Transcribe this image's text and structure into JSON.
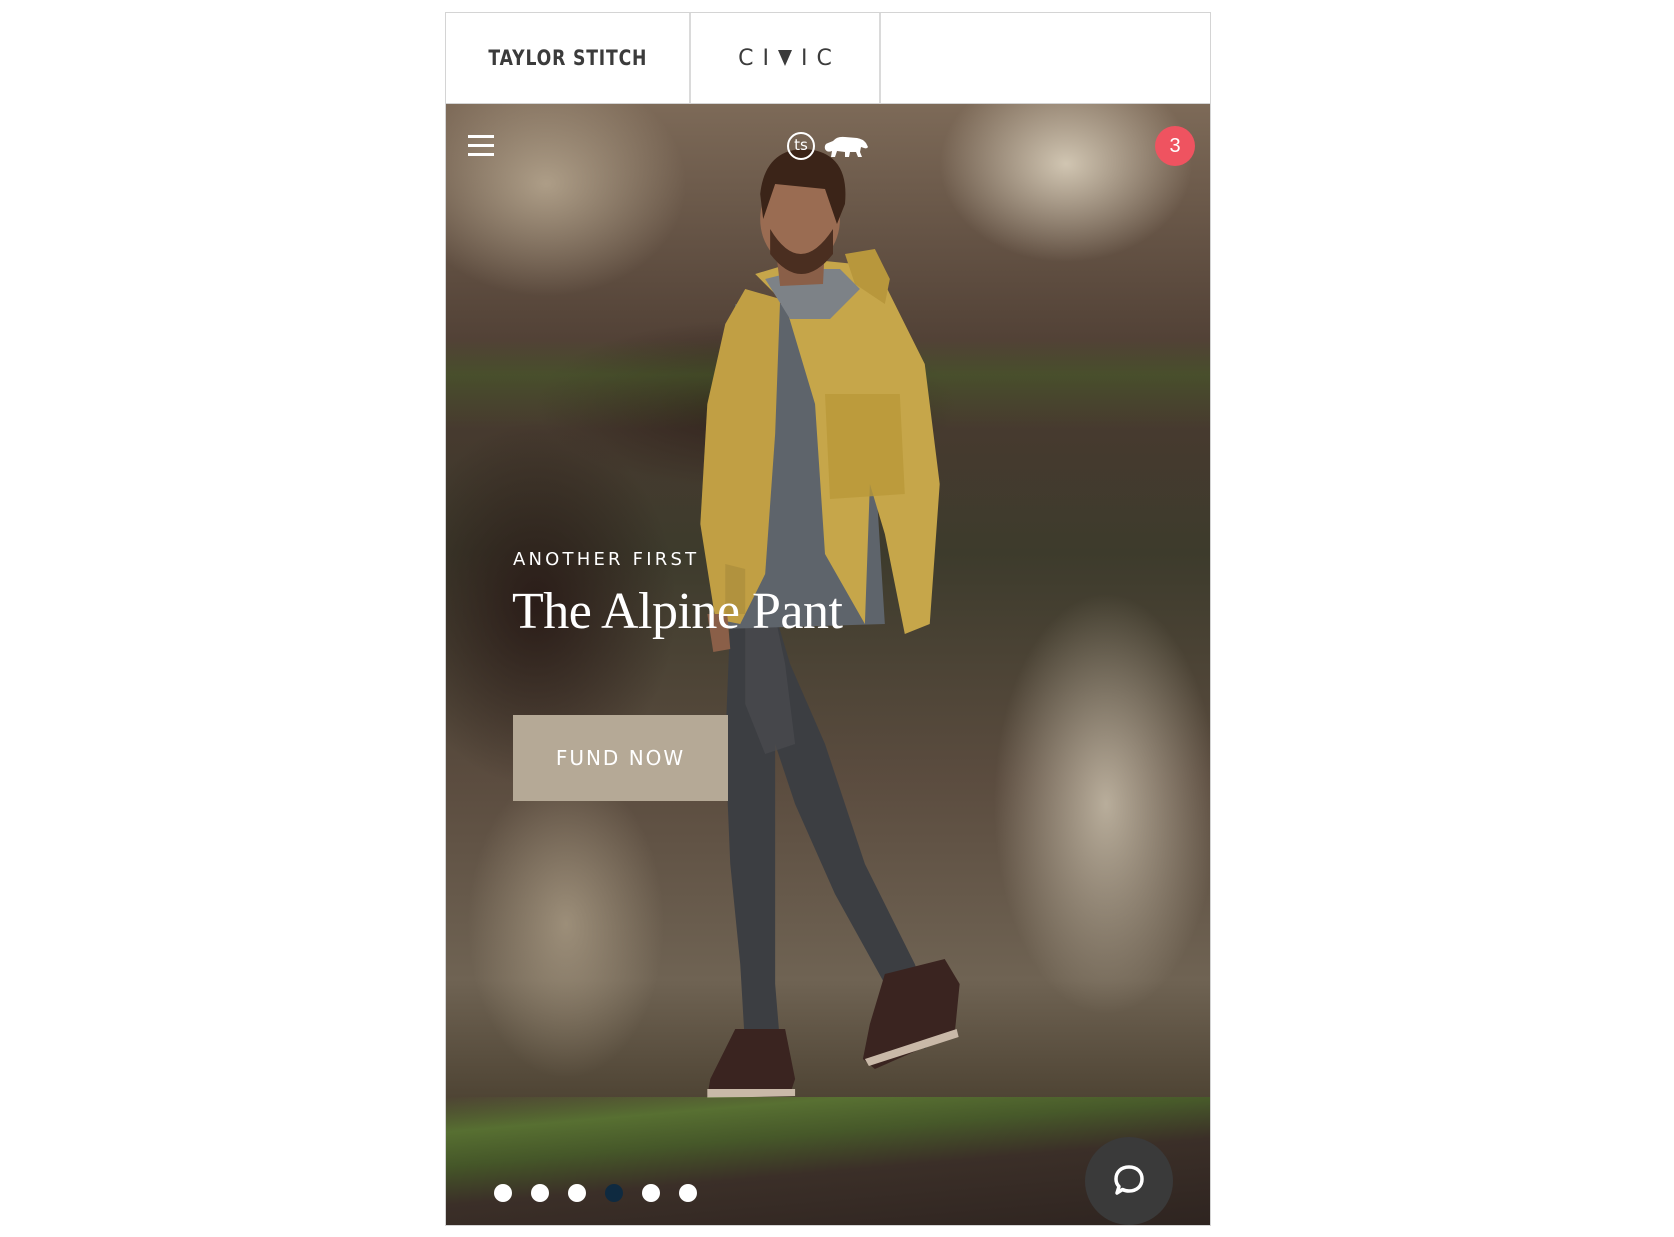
{
  "brand_tabs": [
    {
      "label": "TAYLOR STITCH",
      "active": true
    },
    {
      "label_left": "CI",
      "label_right": "IC",
      "full_label": "CIVIC",
      "active": false
    }
  ],
  "hero": {
    "menu_icon": "hamburger-menu-icon",
    "logo": {
      "monogram": "ts",
      "mascot": "bear-icon"
    },
    "cart_count": "3",
    "eyebrow": "ANOTHER FIRST",
    "headline": "The Alpine Pant",
    "cta_label": "FUND NOW",
    "carousel": {
      "total": 6,
      "active_index": 3
    },
    "chat_icon": "chat-bubble-icon"
  },
  "colors": {
    "cta_bg": "#b5a996",
    "badge_bg": "#ef5360",
    "active_dot": "#0f2a40",
    "chat_bg": "#3a3a3a"
  }
}
